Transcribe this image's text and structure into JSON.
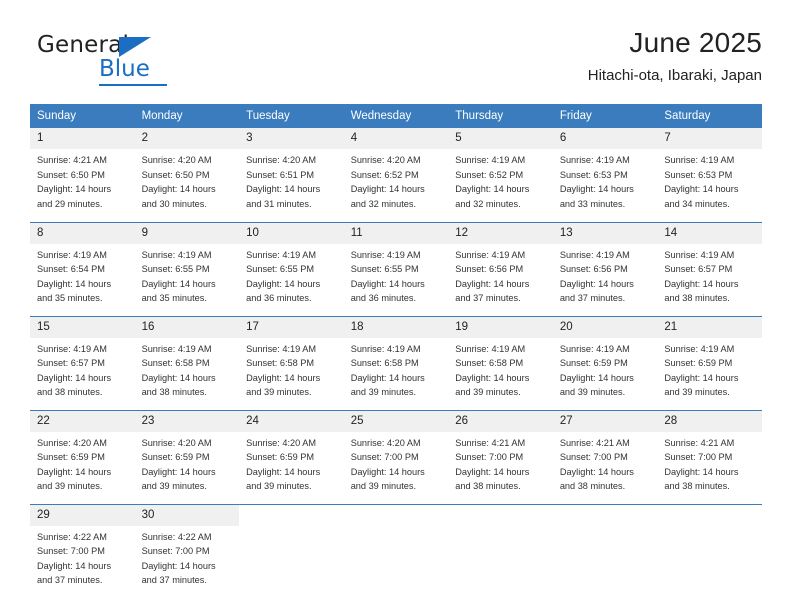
{
  "brand": {
    "name_primary": "General",
    "name_secondary": "Blue",
    "accent_color": "#1b6ec2"
  },
  "header": {
    "title": "June 2025",
    "subtitle": "Hitachi-ota, Ibaraki, Japan"
  },
  "theme": {
    "header_blue": "#3a7cbd",
    "daynum_gray": "#f0f0f0",
    "text": "#222222"
  },
  "weekdays": [
    "Sunday",
    "Monday",
    "Tuesday",
    "Wednesday",
    "Thursday",
    "Friday",
    "Saturday"
  ],
  "labels": {
    "sunrise_prefix": "Sunrise:",
    "sunset_prefix": "Sunset:",
    "daylight_prefix": "Daylight:"
  },
  "weeks": [
    [
      {
        "day": "1",
        "sunrise": "Sunrise: 4:21 AM",
        "sunset": "Sunset: 6:50 PM",
        "daylight": "Daylight: 14 hours and 29 minutes."
      },
      {
        "day": "2",
        "sunrise": "Sunrise: 4:20 AM",
        "sunset": "Sunset: 6:50 PM",
        "daylight": "Daylight: 14 hours and 30 minutes."
      },
      {
        "day": "3",
        "sunrise": "Sunrise: 4:20 AM",
        "sunset": "Sunset: 6:51 PM",
        "daylight": "Daylight: 14 hours and 31 minutes."
      },
      {
        "day": "4",
        "sunrise": "Sunrise: 4:20 AM",
        "sunset": "Sunset: 6:52 PM",
        "daylight": "Daylight: 14 hours and 32 minutes."
      },
      {
        "day": "5",
        "sunrise": "Sunrise: 4:19 AM",
        "sunset": "Sunset: 6:52 PM",
        "daylight": "Daylight: 14 hours and 32 minutes."
      },
      {
        "day": "6",
        "sunrise": "Sunrise: 4:19 AM",
        "sunset": "Sunset: 6:53 PM",
        "daylight": "Daylight: 14 hours and 33 minutes."
      },
      {
        "day": "7",
        "sunrise": "Sunrise: 4:19 AM",
        "sunset": "Sunset: 6:53 PM",
        "daylight": "Daylight: 14 hours and 34 minutes."
      }
    ],
    [
      {
        "day": "8",
        "sunrise": "Sunrise: 4:19 AM",
        "sunset": "Sunset: 6:54 PM",
        "daylight": "Daylight: 14 hours and 35 minutes."
      },
      {
        "day": "9",
        "sunrise": "Sunrise: 4:19 AM",
        "sunset": "Sunset: 6:55 PM",
        "daylight": "Daylight: 14 hours and 35 minutes."
      },
      {
        "day": "10",
        "sunrise": "Sunrise: 4:19 AM",
        "sunset": "Sunset: 6:55 PM",
        "daylight": "Daylight: 14 hours and 36 minutes."
      },
      {
        "day": "11",
        "sunrise": "Sunrise: 4:19 AM",
        "sunset": "Sunset: 6:55 PM",
        "daylight": "Daylight: 14 hours and 36 minutes."
      },
      {
        "day": "12",
        "sunrise": "Sunrise: 4:19 AM",
        "sunset": "Sunset: 6:56 PM",
        "daylight": "Daylight: 14 hours and 37 minutes."
      },
      {
        "day": "13",
        "sunrise": "Sunrise: 4:19 AM",
        "sunset": "Sunset: 6:56 PM",
        "daylight": "Daylight: 14 hours and 37 minutes."
      },
      {
        "day": "14",
        "sunrise": "Sunrise: 4:19 AM",
        "sunset": "Sunset: 6:57 PM",
        "daylight": "Daylight: 14 hours and 38 minutes."
      }
    ],
    [
      {
        "day": "15",
        "sunrise": "Sunrise: 4:19 AM",
        "sunset": "Sunset: 6:57 PM",
        "daylight": "Daylight: 14 hours and 38 minutes."
      },
      {
        "day": "16",
        "sunrise": "Sunrise: 4:19 AM",
        "sunset": "Sunset: 6:58 PM",
        "daylight": "Daylight: 14 hours and 38 minutes."
      },
      {
        "day": "17",
        "sunrise": "Sunrise: 4:19 AM",
        "sunset": "Sunset: 6:58 PM",
        "daylight": "Daylight: 14 hours and 39 minutes."
      },
      {
        "day": "18",
        "sunrise": "Sunrise: 4:19 AM",
        "sunset": "Sunset: 6:58 PM",
        "daylight": "Daylight: 14 hours and 39 minutes."
      },
      {
        "day": "19",
        "sunrise": "Sunrise: 4:19 AM",
        "sunset": "Sunset: 6:58 PM",
        "daylight": "Daylight: 14 hours and 39 minutes."
      },
      {
        "day": "20",
        "sunrise": "Sunrise: 4:19 AM",
        "sunset": "Sunset: 6:59 PM",
        "daylight": "Daylight: 14 hours and 39 minutes."
      },
      {
        "day": "21",
        "sunrise": "Sunrise: 4:19 AM",
        "sunset": "Sunset: 6:59 PM",
        "daylight": "Daylight: 14 hours and 39 minutes."
      }
    ],
    [
      {
        "day": "22",
        "sunrise": "Sunrise: 4:20 AM",
        "sunset": "Sunset: 6:59 PM",
        "daylight": "Daylight: 14 hours and 39 minutes."
      },
      {
        "day": "23",
        "sunrise": "Sunrise: 4:20 AM",
        "sunset": "Sunset: 6:59 PM",
        "daylight": "Daylight: 14 hours and 39 minutes."
      },
      {
        "day": "24",
        "sunrise": "Sunrise: 4:20 AM",
        "sunset": "Sunset: 6:59 PM",
        "daylight": "Daylight: 14 hours and 39 minutes."
      },
      {
        "day": "25",
        "sunrise": "Sunrise: 4:20 AM",
        "sunset": "Sunset: 7:00 PM",
        "daylight": "Daylight: 14 hours and 39 minutes."
      },
      {
        "day": "26",
        "sunrise": "Sunrise: 4:21 AM",
        "sunset": "Sunset: 7:00 PM",
        "daylight": "Daylight: 14 hours and 38 minutes."
      },
      {
        "day": "27",
        "sunrise": "Sunrise: 4:21 AM",
        "sunset": "Sunset: 7:00 PM",
        "daylight": "Daylight: 14 hours and 38 minutes."
      },
      {
        "day": "28",
        "sunrise": "Sunrise: 4:21 AM",
        "sunset": "Sunset: 7:00 PM",
        "daylight": "Daylight: 14 hours and 38 minutes."
      }
    ],
    [
      {
        "day": "29",
        "sunrise": "Sunrise: 4:22 AM",
        "sunset": "Sunset: 7:00 PM",
        "daylight": "Daylight: 14 hours and 37 minutes."
      },
      {
        "day": "30",
        "sunrise": "Sunrise: 4:22 AM",
        "sunset": "Sunset: 7:00 PM",
        "daylight": "Daylight: 14 hours and 37 minutes."
      },
      {
        "day": "",
        "sunrise": "",
        "sunset": "",
        "daylight": ""
      },
      {
        "day": "",
        "sunrise": "",
        "sunset": "",
        "daylight": ""
      },
      {
        "day": "",
        "sunrise": "",
        "sunset": "",
        "daylight": ""
      },
      {
        "day": "",
        "sunrise": "",
        "sunset": "",
        "daylight": ""
      },
      {
        "day": "",
        "sunrise": "",
        "sunset": "",
        "daylight": ""
      }
    ]
  ]
}
